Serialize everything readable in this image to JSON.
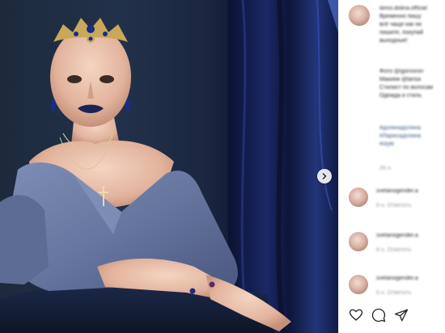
{
  "post": {
    "username": "lariss.dolina.official",
    "caption_lines": [
      "Временно пишу",
      "всё чаще как ни",
      "пишите, покупай",
      "выходные!"
    ],
    "credits_lines": [
      "Фото @igorvoron",
      "Макияж @larisa",
      "Стилист по волосам",
      "Одежда и стиль"
    ],
    "hashtag_lines": [
      "#долинадолина",
      "#Ларисадолина",
      "#style"
    ],
    "date_short": "26 н."
  },
  "comments": [
    {
      "username": "svetanogender.a",
      "meta": "8 н.  Ответить"
    },
    {
      "username": "svetanogender.a",
      "meta": "8 н.  Ответить"
    },
    {
      "username": "svetanogender.a",
      "meta": "8 н.  Ответить"
    }
  ],
  "icons": {
    "next": "chevron-right-icon",
    "like": "heart-icon",
    "comment": "comment-icon",
    "share": "paper-plane-icon"
  },
  "colors": {
    "accent_link": "#3a5a8c",
    "background": "#ffffff",
    "photo_backdrop": "#1d2a3c",
    "curtain": "#142055",
    "dress": "#6f7fa8"
  }
}
